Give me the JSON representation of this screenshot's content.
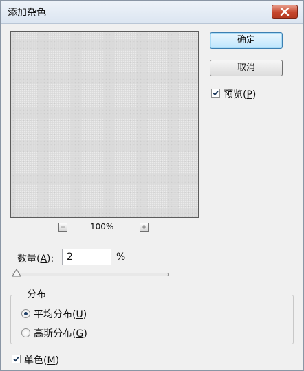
{
  "window": {
    "title": "添加杂色"
  },
  "buttons": {
    "ok_label": "确定",
    "cancel_label": "取消"
  },
  "preview_option": {
    "label": "预览",
    "hotkey": "P",
    "checked": true
  },
  "zoom": {
    "level": "100%"
  },
  "amount": {
    "label": "数量",
    "hotkey": "A",
    "value": "2",
    "unit": "%",
    "slider_fraction": 0.0
  },
  "distribution": {
    "legend": "分布",
    "options": [
      {
        "label": "平均分布",
        "hotkey": "U",
        "selected": true
      },
      {
        "label": "高斯分布",
        "hotkey": "G",
        "selected": false
      }
    ]
  },
  "monochrome": {
    "label": "单色",
    "hotkey": "M",
    "checked": true
  }
}
